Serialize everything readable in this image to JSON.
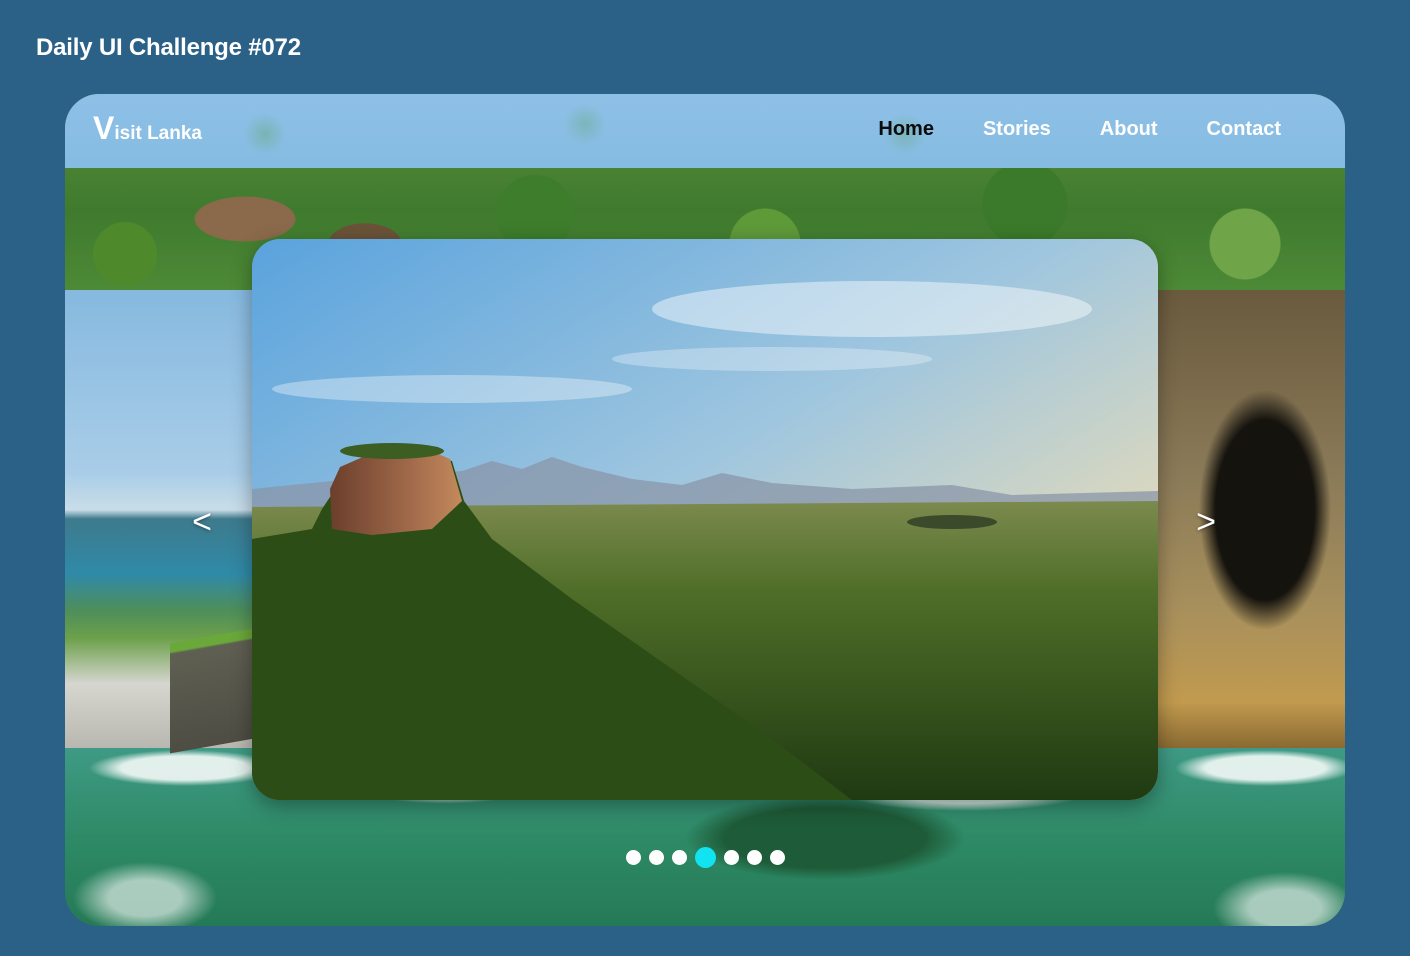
{
  "page": {
    "title": "Daily UI Challenge #072"
  },
  "header": {
    "logo_initial": "V",
    "logo_rest": "isit Lanka",
    "nav": [
      {
        "label": "Home",
        "active": true
      },
      {
        "label": "Stories",
        "active": false
      },
      {
        "label": "About",
        "active": false
      },
      {
        "label": "Contact",
        "active": false
      }
    ]
  },
  "carousel": {
    "prev_label": "<",
    "next_label": ">",
    "slide_count": 7,
    "active_index": 3,
    "active_dot_color": "#11e3f1"
  },
  "colors": {
    "page_background": "#2b6087",
    "header_background": "#8ec0e6",
    "active_nav_text": "#0c0c0c"
  }
}
